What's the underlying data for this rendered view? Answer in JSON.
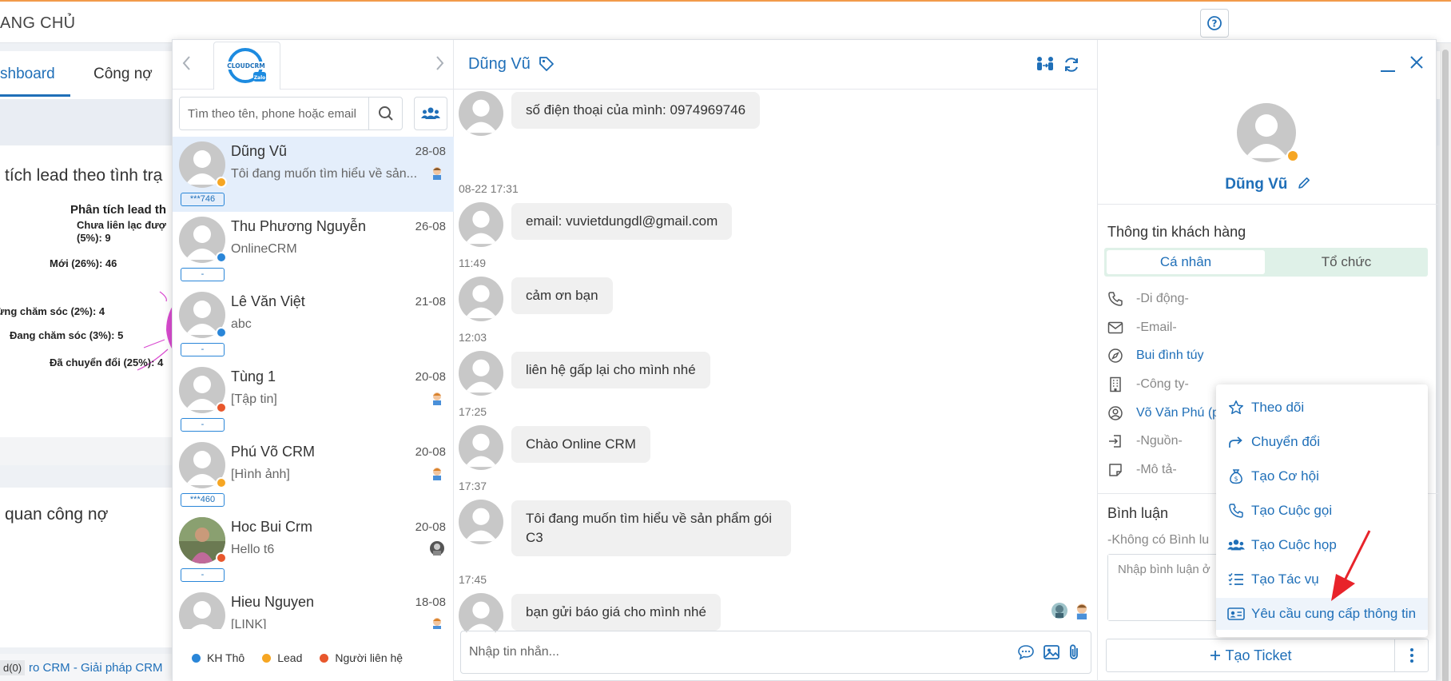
{
  "background": {
    "page_title": "ANG CHỦ",
    "tabs": [
      "shboard",
      "Công nợ"
    ],
    "card1_title": "tích lead theo tình trạ",
    "card1_subtitle": "Phân tích lead th",
    "pie_labels": [
      "Chưa liên lạc đượ",
      "(5%): 9",
      "Mới (26%): 46",
      "ừng chăm sóc (2%): 4",
      "Đang chăm sóc (3%): 5",
      "Đã chuyển đổi (25%): 4"
    ],
    "card2_title": "quan công nợ",
    "footer_text": "ro CRM - Giải pháp CRM",
    "footer_badge": "d(0)"
  },
  "left_panel": {
    "search_placeholder": "Tìm theo tên, phone hoặc email",
    "contacts": [
      {
        "name": "Dũng Vũ",
        "date": "28-08",
        "preview": "Tôi đang muốn tìm hiểu về sản...",
        "phone": "***746"
      },
      {
        "name": "Thu Phương Nguyễn",
        "date": "26-08",
        "preview": "OnlineCRM",
        "phone": "-"
      },
      {
        "name": "Lê Văn Việt",
        "date": "21-08",
        "preview": "abc",
        "phone": "-"
      },
      {
        "name": "Tùng 1",
        "date": "20-08",
        "preview": "[Tập tin]",
        "phone": "-"
      },
      {
        "name": "Phú Võ CRM",
        "date": "20-08",
        "preview": "[Hình ảnh]",
        "phone": "***460"
      },
      {
        "name": "Hoc Bui Crm",
        "date": "20-08",
        "preview": "Hello t6",
        "phone": "-"
      },
      {
        "name": "Hieu Nguyen",
        "date": "18-08",
        "preview": "[LINK]",
        "phone": ""
      }
    ],
    "legend": [
      {
        "label": "KH Thô",
        "color": "#2a86d8"
      },
      {
        "label": "Lead",
        "color": "#f6a623"
      },
      {
        "label": "Người liên hệ",
        "color": "#e8572c"
      }
    ]
  },
  "conversation": {
    "contact_name": "Dũng Vũ",
    "messages": [
      {
        "time": "",
        "text": "số điện thoại của mình: 0974969746"
      },
      {
        "time": "08-22 17:31",
        "text": "email: vuvietdungdl@gmail.com"
      },
      {
        "time": "11:49",
        "text": "cảm ơn bạn"
      },
      {
        "time": "12:03",
        "text": "liên hệ gấp lại cho mình nhé"
      },
      {
        "time": "17:25",
        "text": "Chào Online CRM"
      },
      {
        "time": "17:37",
        "text": "Tôi đang muốn tìm hiểu về sản phẩm gói C3"
      },
      {
        "time": "17:45",
        "text": "bạn gửi báo giá cho mình nhé"
      }
    ],
    "composer_placeholder": "Nhập tin nhắn..."
  },
  "right_panel": {
    "profile_name": "Dũng Vũ",
    "info_title": "Thông tin khách hàng",
    "segments": [
      "Cá nhân",
      "Tổ chức"
    ],
    "fields": {
      "mobile": "-Di động-",
      "email": "-Email-",
      "address": "Bui đình túy",
      "company": "-Công ty-",
      "owner": "Võ Văn Phú (ph",
      "source": "-Nguồn-",
      "description": "-Mô tả-"
    },
    "comment_title": "Bình luận",
    "comment_empty": "-Không có Bình lu",
    "comment_placeholder": "Nhập bình luận ở",
    "ticket_label": "Tạo Ticket"
  },
  "dropdown": {
    "items": [
      "Theo dõi",
      "Chuyển đổi",
      "Tạo Cơ hội",
      "Tạo Cuộc gọi",
      "Tạo Cuộc họp",
      "Tạo Tác vụ",
      "Yêu cầu cung cấp thông tin"
    ]
  },
  "colors": {
    "accent": "#1f6fb8",
    "segment_bg": "#dff1e8",
    "active_contact": "#e4eefb",
    "annotation_arrow": "#e8232a"
  }
}
